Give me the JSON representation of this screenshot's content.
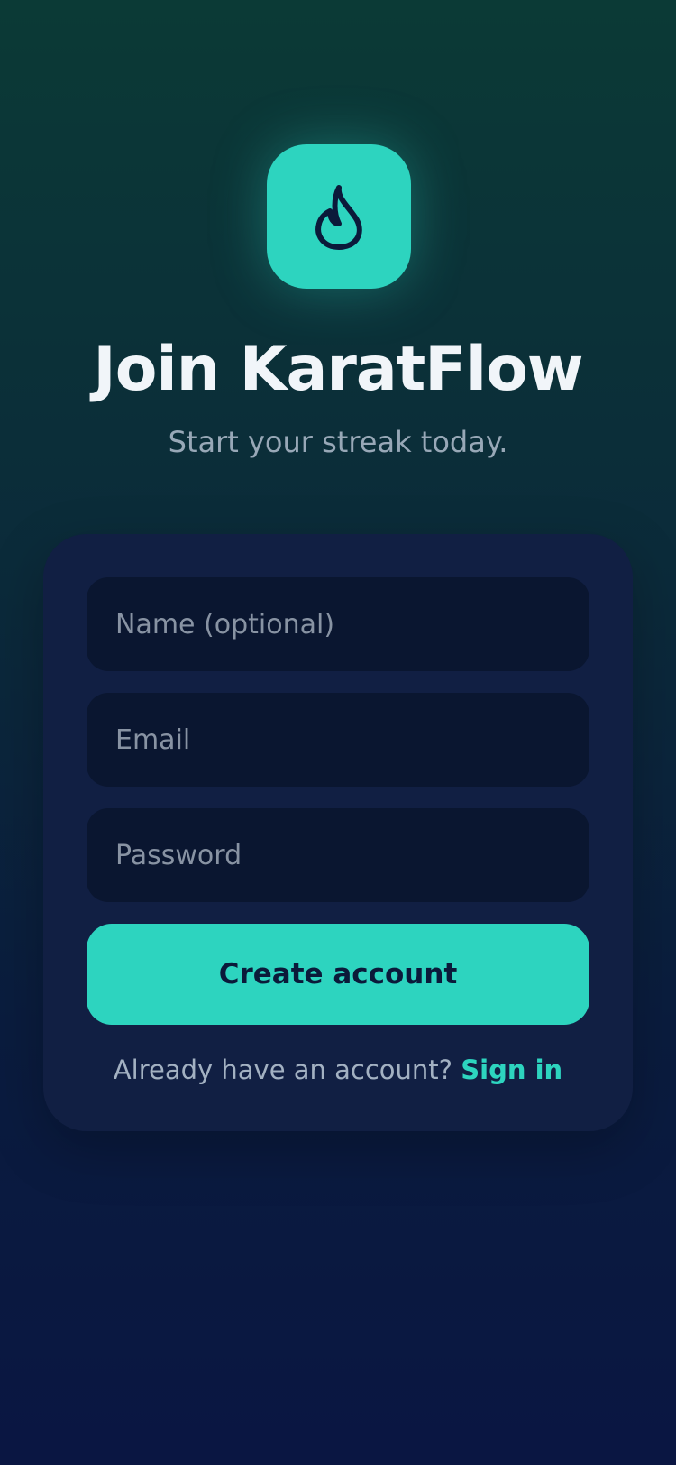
{
  "app": {
    "icon": "flame-icon",
    "title": "Join KaratFlow",
    "subtitle": "Start your streak today."
  },
  "form": {
    "name_placeholder": "Name (optional)",
    "email_placeholder": "Email",
    "password_placeholder": "Password",
    "submit_label": "Create account",
    "signin_prompt": "Already have an account?",
    "signin_link": "Sign in"
  },
  "colors": {
    "accent": "#2dd4bf",
    "card": "#111f43",
    "field": "#0a1630",
    "background_top": "#0b3a36",
    "background_bottom": "#0a1642"
  }
}
